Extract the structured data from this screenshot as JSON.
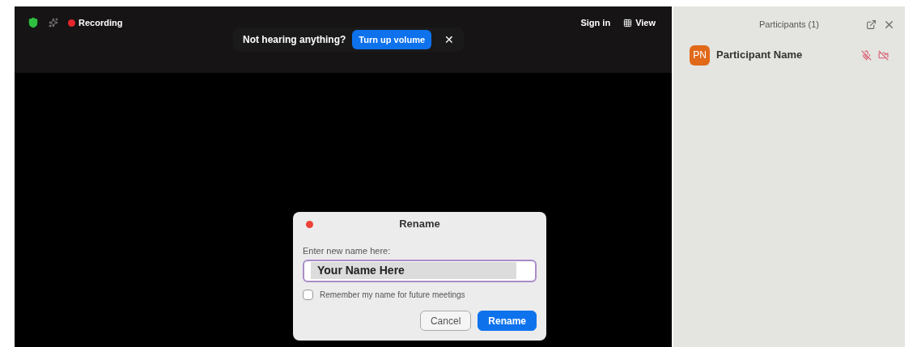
{
  "top_bar": {
    "recording": {
      "label": "Recording",
      "on": true
    },
    "sign_in": "Sign in",
    "view": "View"
  },
  "notice": {
    "text": "Not hearing anything?",
    "action": "Turn up volume",
    "close": "✕"
  },
  "participants_panel": {
    "title": "Participants (1)",
    "participants": [
      {
        "initials": "PN",
        "name": "Participant Name",
        "muted": true,
        "video_off": true
      }
    ]
  },
  "dialog": {
    "title": "Rename",
    "label": "Enter new name here:",
    "value": "Your Name Here",
    "value_selected": true,
    "remember": {
      "label": "Remember my name for future meetings",
      "checked": false
    },
    "buttons": [
      {
        "label": "Cancel",
        "kind": "secondary"
      },
      {
        "label": "Rename",
        "kind": "primary"
      }
    ]
  }
}
